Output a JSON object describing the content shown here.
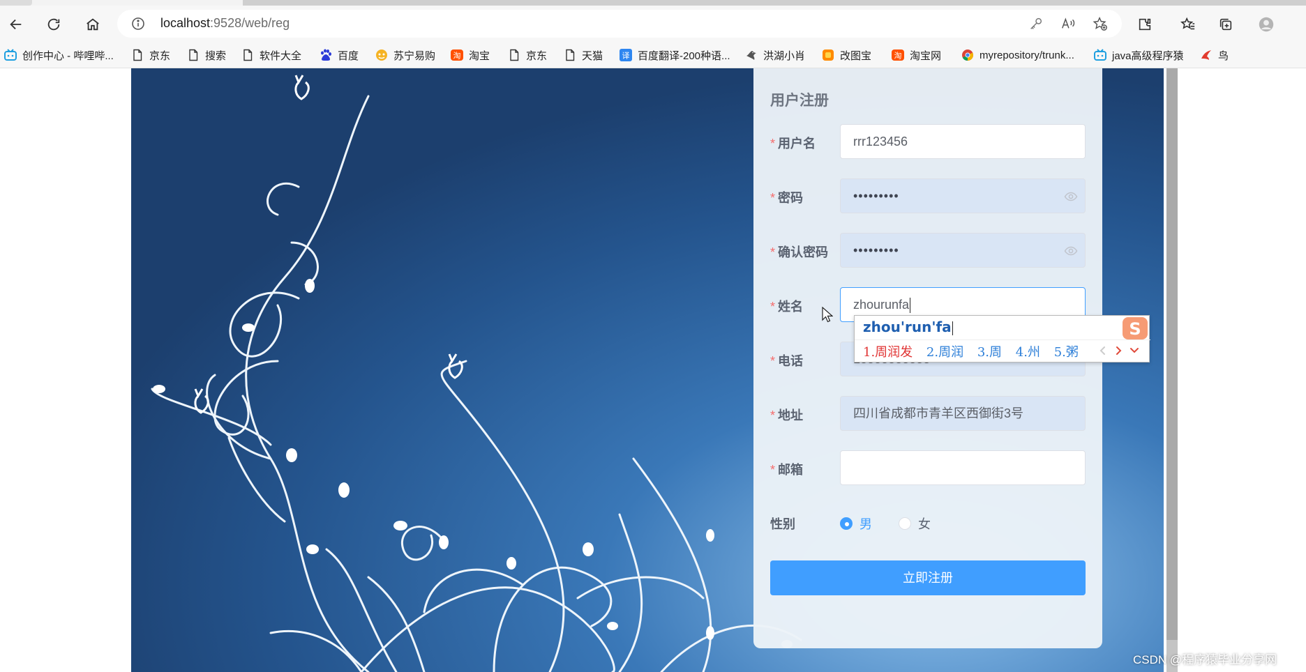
{
  "browser": {
    "url_host": "localhost",
    "url_rest": ":9528/web/reg"
  },
  "bookmarks": [
    {
      "label": "创作中心 - 哔哩哔...",
      "icon": "bilibili-icon"
    },
    {
      "label": "京东",
      "icon": "page-icon"
    },
    {
      "label": "搜索",
      "icon": "page-icon"
    },
    {
      "label": "软件大全",
      "icon": "page-icon"
    },
    {
      "label": "百度",
      "icon": "baidu-icon"
    },
    {
      "label": "苏宁易购",
      "icon": "suning-icon"
    },
    {
      "label": "淘宝",
      "icon": "taobao-icon"
    },
    {
      "label": "京东",
      "icon": "page-icon"
    },
    {
      "label": "天猫",
      "icon": "page-icon"
    },
    {
      "label": "百度翻译-200种语...",
      "icon": "translate-icon"
    },
    {
      "label": "洪湖小肖",
      "icon": "bird-icon"
    },
    {
      "label": "改图宝",
      "icon": "gaitubao-icon"
    },
    {
      "label": "淘宝网",
      "icon": "taobao-icon"
    },
    {
      "label": "myrepository/trunk...",
      "icon": "chrome-icon"
    },
    {
      "label": "java高级程序猿",
      "icon": "bilibili-icon"
    },
    {
      "label": "鸟",
      "icon": "bird-icon"
    }
  ],
  "form": {
    "title": "用户注册",
    "required_mark": "*",
    "username": {
      "label": "用户名",
      "value": "rrr123456"
    },
    "password": {
      "label": "密码",
      "value": "•••••••••"
    },
    "confirm_password": {
      "label": "确认密码",
      "value": "•••••••••"
    },
    "name": {
      "label": "姓名",
      "value": "zhourunfa"
    },
    "phone": {
      "label": "电话",
      "value": "18888888888"
    },
    "address": {
      "label": "地址",
      "value": "四川省成都市青羊区西御街3号"
    },
    "email": {
      "label": "邮箱",
      "value": ""
    },
    "gender": {
      "label": "性别",
      "options": [
        "男",
        "女"
      ],
      "selected": "男"
    },
    "submit_label": "立即注册"
  },
  "ime": {
    "composition": "zhou'run'fa",
    "candidates": [
      "1.周润发",
      "2.周润",
      "3.周",
      "4.州",
      "5.粥"
    ]
  },
  "watermark": "CSDN @程序猿毕业分享网",
  "colors": {
    "accent": "#409eff",
    "required": "#f56c6c",
    "background_art": "#1f4f86"
  }
}
